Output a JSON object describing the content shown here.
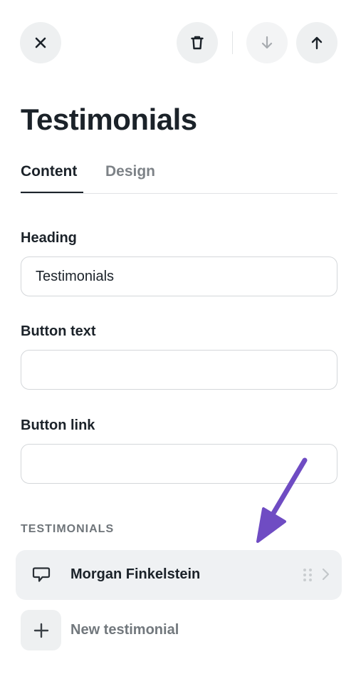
{
  "toolbar": {
    "close_label": "Close",
    "delete_label": "Delete",
    "move_down_label": "Move down",
    "move_up_label": "Move up"
  },
  "page": {
    "title": "Testimonials"
  },
  "tabs": [
    {
      "label": "Content",
      "active": true
    },
    {
      "label": "Design",
      "active": false
    }
  ],
  "fields": {
    "heading": {
      "label": "Heading",
      "value": "Testimonials",
      "placeholder": ""
    },
    "button_text": {
      "label": "Button text",
      "value": "",
      "placeholder": ""
    },
    "button_link": {
      "label": "Button link",
      "value": "",
      "placeholder": ""
    }
  },
  "testimonials_section": {
    "label": "TESTIMONIALS",
    "items": [
      {
        "name": "Morgan Finkelstein"
      }
    ],
    "add_label": "New testimonial"
  },
  "icons": {
    "close": "close-icon",
    "delete": "trash-icon",
    "move_down": "arrow-down-icon",
    "move_up": "arrow-up-icon",
    "testimonial": "chat-bubble-icon",
    "drag": "drag-handle-icon",
    "chevron": "chevron-right-icon",
    "add": "plus-icon"
  },
  "colors": {
    "text_primary": "#1b2229",
    "text_muted": "#7d8287",
    "button_bg": "#eef0f1",
    "row_bg": "#eff1f3",
    "annotation_arrow": "#6f4cc3"
  }
}
